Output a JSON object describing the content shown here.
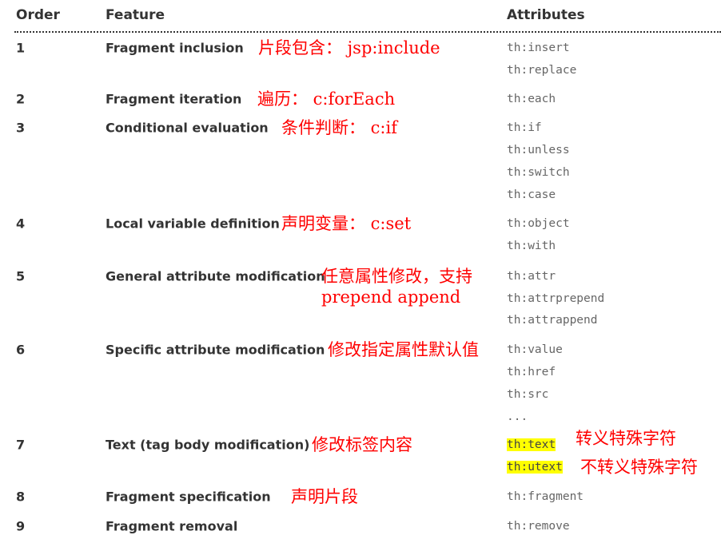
{
  "header": {
    "order": "Order",
    "feature": "Feature",
    "attributes": "Attributes"
  },
  "rows": [
    {
      "order": "1",
      "feature": "Fragment inclusion",
      "attributes": [
        "th:insert",
        "th:replace"
      ],
      "note": [
        "片段包含： jsp:include"
      ]
    },
    {
      "order": "2",
      "feature": "Fragment iteration",
      "attributes": [
        "th:each"
      ],
      "note": [
        "遍历： c:forEach"
      ]
    },
    {
      "order": "3",
      "feature": "Conditional evaluation",
      "attributes": [
        "th:if",
        "th:unless",
        "th:switch",
        "th:case"
      ],
      "note": [
        "条件判断： c:if"
      ]
    },
    {
      "order": "4",
      "feature": "Local variable definition",
      "attributes": [
        "th:object",
        "th:with"
      ],
      "note": [
        "声明变量： c:set"
      ]
    },
    {
      "order": "5",
      "feature": "General attribute modification",
      "attributes": [
        "th:attr",
        "th:attrprepend",
        "th:attrappend"
      ],
      "note": [
        "任意属性修改，支持",
        "prepend  append"
      ]
    },
    {
      "order": "6",
      "feature": "Specific attribute modification",
      "attributes": [
        "th:value",
        "th:href",
        "th:src",
        "..."
      ],
      "note": [
        "修改指定属性默认值"
      ]
    },
    {
      "order": "7",
      "feature": "Text (tag body modification)",
      "attributes": [
        "th:text",
        "th:utext"
      ],
      "note": [
        "修改标签内容"
      ],
      "highlight": true,
      "attr_notes": [
        "转义特殊字符",
        "不转义特殊字符"
      ]
    },
    {
      "order": "8",
      "feature": "Fragment specification",
      "attributes": [
        "th:fragment"
      ],
      "note": [
        "声明片段"
      ]
    },
    {
      "order": "9",
      "feature": "Fragment removal",
      "attributes": [
        "th:remove"
      ],
      "note": []
    }
  ],
  "colors": {
    "annotation": "#ff0000",
    "highlight": "#ffff00"
  }
}
